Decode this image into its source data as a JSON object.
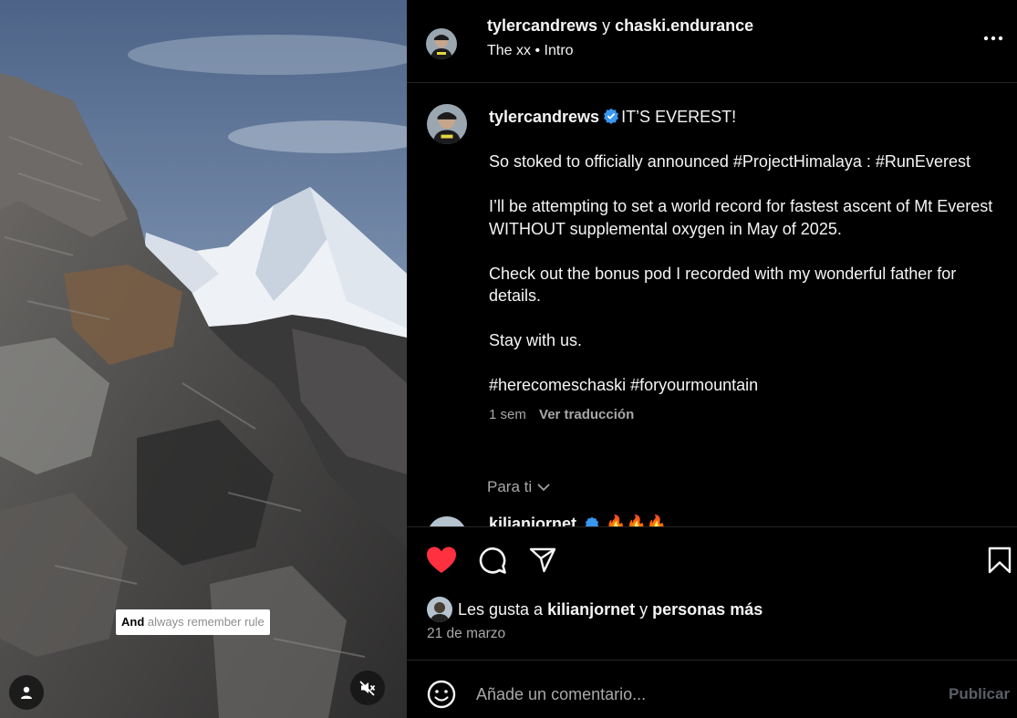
{
  "media": {
    "caption_strong": "And",
    "caption_rest": "always remember rule",
    "user_icon": "person-icon",
    "mute_icon": "speaker-muted-icon"
  },
  "header": {
    "author": "tylercandrews",
    "joiner": "y",
    "collaborator": "chaski.endurance",
    "audio_artist": "The xx",
    "audio_separator": "•",
    "audio_track": "Intro",
    "more_icon": "more-horizontal-icon"
  },
  "post": {
    "username": "tylercandrews",
    "verified_icon": "verified-badge-icon",
    "verified_color": "#3897f0",
    "headline": "IT’S EVEREST!",
    "paragraphs": [
      "So stoked to officially announced #ProjectHimalaya : #RunEverest",
      "I’ll be attempting to set a world record for fastest ascent of Mt Everest WITHOUT supplemental oxygen in May of 2025.",
      "Check out the bonus pod I recorded with my wonderful father for details.",
      "Stay with us.",
      "#herecomeschaski #foryourmountain"
    ],
    "time_ago": "1 sem",
    "translate_label": "Ver traducción"
  },
  "comments": {
    "filter_label": "Para ti",
    "next_comment_user": "kilianjornet",
    "next_comment_emoji": "🔥🔥🔥"
  },
  "actions": {
    "like_icon": "heart-filled-icon",
    "like_color": "#ff3040",
    "comment_icon": "comment-icon",
    "share_icon": "send-icon",
    "save_icon": "bookmark-icon"
  },
  "likes": {
    "prefix": "Les gusta a",
    "user": "kilianjornet",
    "joiner": "y",
    "others": "personas más"
  },
  "date": "21 de marzo",
  "comment_bar": {
    "emoji_icon": "emoji-icon",
    "placeholder": "Añade un comentario...",
    "publish_label": "Publicar"
  }
}
